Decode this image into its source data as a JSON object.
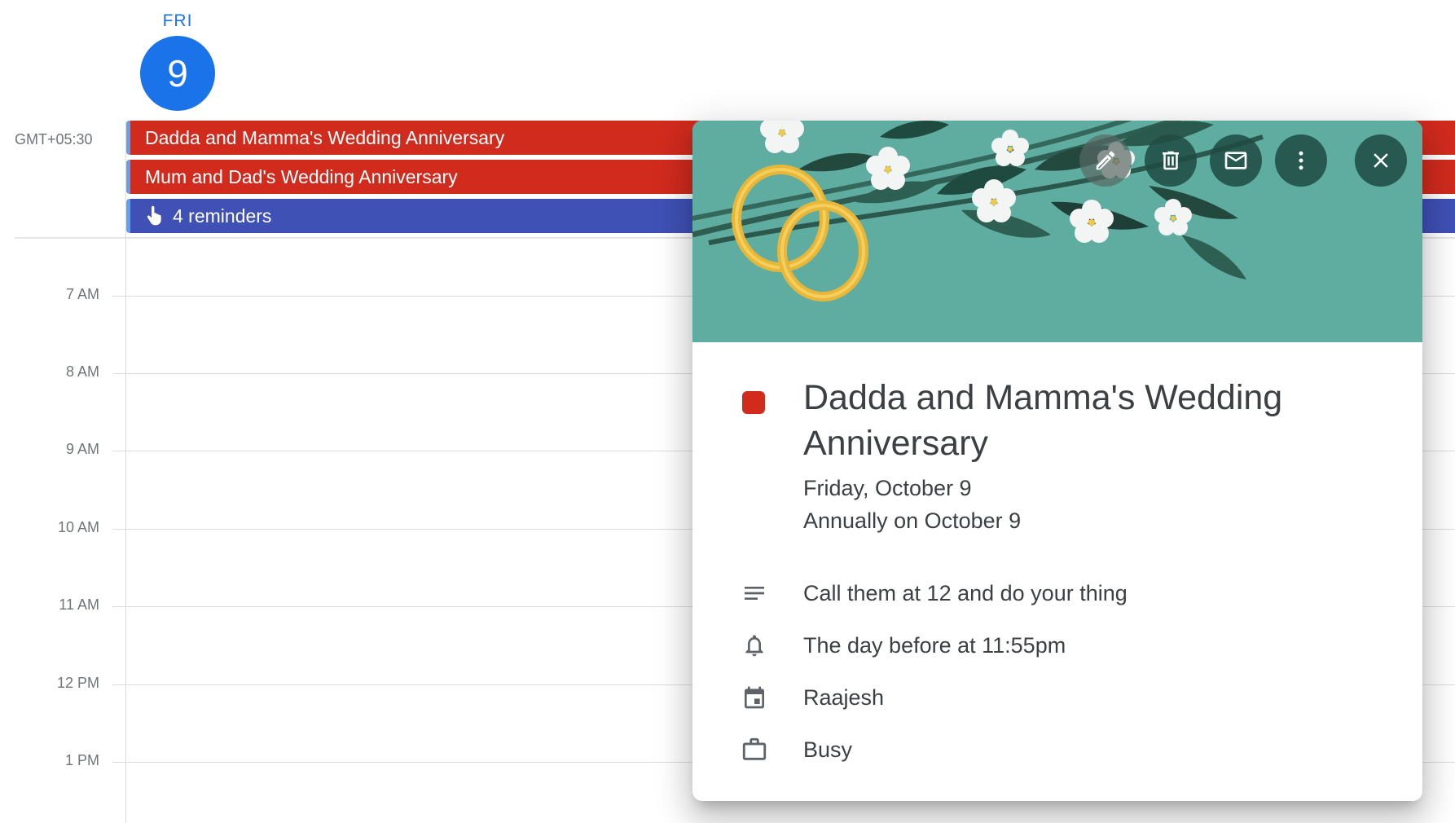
{
  "header": {
    "day_name": "FRI",
    "day_number": "9"
  },
  "timezone_label": "GMT+05:30",
  "allday_events": [
    {
      "title": "Dadda and Mamma's Wedding Anniversary",
      "color": "#d12b1e"
    },
    {
      "title": "Mum and Dad's Wedding Anniversary",
      "color": "#d12b1e"
    },
    {
      "title": "4 reminders",
      "color": "#3f51b5",
      "icon": "reminder-hand-icon"
    }
  ],
  "hours": [
    "7 AM",
    "8 AM",
    "9 AM",
    "10 AM",
    "11 AM",
    "12 PM",
    "1 PM"
  ],
  "popover": {
    "banner_theme": "wedding-rings-flowers",
    "banner_color": "#5fada0",
    "actions": [
      {
        "name": "edit",
        "icon": "pencil-icon"
      },
      {
        "name": "delete",
        "icon": "trash-icon"
      },
      {
        "name": "email",
        "icon": "envelope-icon"
      },
      {
        "name": "more",
        "icon": "more-vert-icon"
      },
      {
        "name": "close",
        "icon": "close-icon"
      }
    ],
    "event": {
      "color": "#d12b1e",
      "title": "Dadda and Mamma's Wedding Anniversary",
      "date": "Friday, October 9",
      "recurrence": "Annually on October 9",
      "description": "Call them at 12 and do your thing",
      "notification": "The day before at 11:55pm",
      "calendar": "Raajesh",
      "availability": "Busy"
    }
  },
  "colors": {
    "accent": "#1a73e8",
    "event_red": "#d12b1e",
    "reminder_blue": "#3f51b5"
  }
}
